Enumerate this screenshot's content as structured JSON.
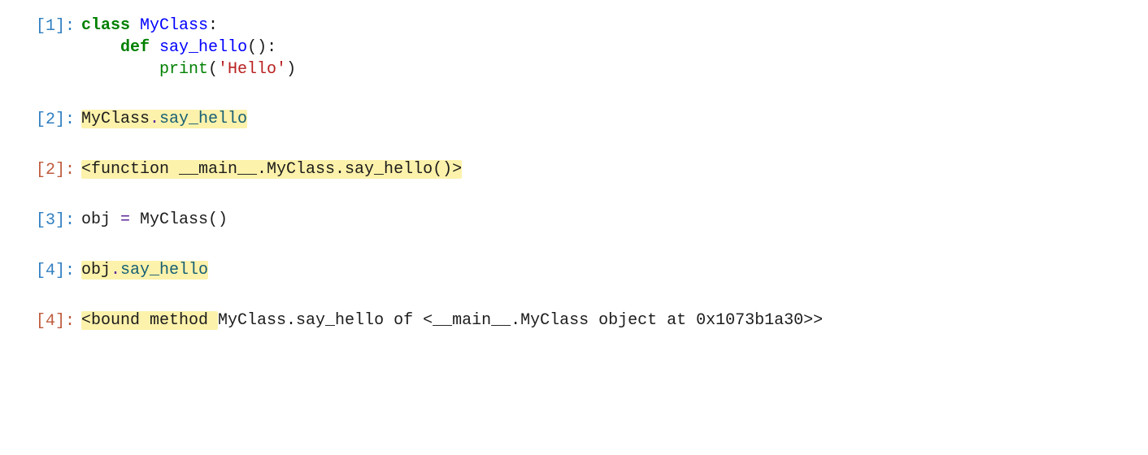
{
  "cells": {
    "c1": {
      "in_prompt": "[1]:",
      "type": "in",
      "code": {
        "class_kw": "class",
        "class_name": "MyClass",
        "colon1": ":",
        "indent1": "    ",
        "def_kw": "def",
        "func_name": "say_hello",
        "parens1": "():",
        "indent2": "        ",
        "print_name": "print",
        "paren_open": "(",
        "string_lit": "'Hello'",
        "paren_close": ")"
      }
    },
    "c2": {
      "in_prompt": "[2]:",
      "type": "in",
      "code": {
        "obj": "MyClass",
        "dot": ".",
        "attr": "say_hello"
      }
    },
    "c2o": {
      "out_prompt": "[2]:",
      "type": "out",
      "text": "<function __main__.MyClass.say_hello()>"
    },
    "c3": {
      "in_prompt": "[3]:",
      "type": "in",
      "code": {
        "lhs": "obj ",
        "eq": "=",
        "rhs1": " MyClass()"
      }
    },
    "c4": {
      "in_prompt": "[4]:",
      "type": "in",
      "code": {
        "obj": "obj",
        "dot": ".",
        "attr": "say_hello"
      }
    },
    "c4o": {
      "out_prompt": "[4]:",
      "type": "out",
      "text_hl": "<bound method ",
      "text_rest": "MyClass.say_hello of <__main__.MyClass object at 0x1073b1a30>>"
    }
  }
}
